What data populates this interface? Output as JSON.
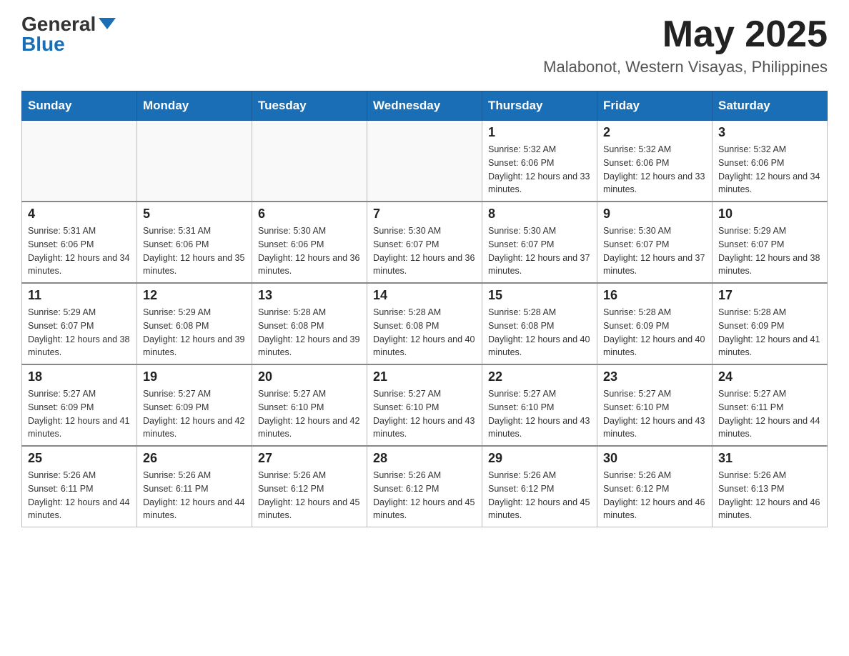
{
  "header": {
    "logo_general": "General",
    "logo_blue": "Blue",
    "month_title": "May 2025",
    "location": "Malabonot, Western Visayas, Philippines"
  },
  "days_of_week": [
    "Sunday",
    "Monday",
    "Tuesday",
    "Wednesday",
    "Thursday",
    "Friday",
    "Saturday"
  ],
  "weeks": [
    [
      {
        "day": "",
        "info": ""
      },
      {
        "day": "",
        "info": ""
      },
      {
        "day": "",
        "info": ""
      },
      {
        "day": "",
        "info": ""
      },
      {
        "day": "1",
        "info": "Sunrise: 5:32 AM\nSunset: 6:06 PM\nDaylight: 12 hours and 33 minutes."
      },
      {
        "day": "2",
        "info": "Sunrise: 5:32 AM\nSunset: 6:06 PM\nDaylight: 12 hours and 33 minutes."
      },
      {
        "day": "3",
        "info": "Sunrise: 5:32 AM\nSunset: 6:06 PM\nDaylight: 12 hours and 34 minutes."
      }
    ],
    [
      {
        "day": "4",
        "info": "Sunrise: 5:31 AM\nSunset: 6:06 PM\nDaylight: 12 hours and 34 minutes."
      },
      {
        "day": "5",
        "info": "Sunrise: 5:31 AM\nSunset: 6:06 PM\nDaylight: 12 hours and 35 minutes."
      },
      {
        "day": "6",
        "info": "Sunrise: 5:30 AM\nSunset: 6:06 PM\nDaylight: 12 hours and 36 minutes."
      },
      {
        "day": "7",
        "info": "Sunrise: 5:30 AM\nSunset: 6:07 PM\nDaylight: 12 hours and 36 minutes."
      },
      {
        "day": "8",
        "info": "Sunrise: 5:30 AM\nSunset: 6:07 PM\nDaylight: 12 hours and 37 minutes."
      },
      {
        "day": "9",
        "info": "Sunrise: 5:30 AM\nSunset: 6:07 PM\nDaylight: 12 hours and 37 minutes."
      },
      {
        "day": "10",
        "info": "Sunrise: 5:29 AM\nSunset: 6:07 PM\nDaylight: 12 hours and 38 minutes."
      }
    ],
    [
      {
        "day": "11",
        "info": "Sunrise: 5:29 AM\nSunset: 6:07 PM\nDaylight: 12 hours and 38 minutes."
      },
      {
        "day": "12",
        "info": "Sunrise: 5:29 AM\nSunset: 6:08 PM\nDaylight: 12 hours and 39 minutes."
      },
      {
        "day": "13",
        "info": "Sunrise: 5:28 AM\nSunset: 6:08 PM\nDaylight: 12 hours and 39 minutes."
      },
      {
        "day": "14",
        "info": "Sunrise: 5:28 AM\nSunset: 6:08 PM\nDaylight: 12 hours and 40 minutes."
      },
      {
        "day": "15",
        "info": "Sunrise: 5:28 AM\nSunset: 6:08 PM\nDaylight: 12 hours and 40 minutes."
      },
      {
        "day": "16",
        "info": "Sunrise: 5:28 AM\nSunset: 6:09 PM\nDaylight: 12 hours and 40 minutes."
      },
      {
        "day": "17",
        "info": "Sunrise: 5:28 AM\nSunset: 6:09 PM\nDaylight: 12 hours and 41 minutes."
      }
    ],
    [
      {
        "day": "18",
        "info": "Sunrise: 5:27 AM\nSunset: 6:09 PM\nDaylight: 12 hours and 41 minutes."
      },
      {
        "day": "19",
        "info": "Sunrise: 5:27 AM\nSunset: 6:09 PM\nDaylight: 12 hours and 42 minutes."
      },
      {
        "day": "20",
        "info": "Sunrise: 5:27 AM\nSunset: 6:10 PM\nDaylight: 12 hours and 42 minutes."
      },
      {
        "day": "21",
        "info": "Sunrise: 5:27 AM\nSunset: 6:10 PM\nDaylight: 12 hours and 43 minutes."
      },
      {
        "day": "22",
        "info": "Sunrise: 5:27 AM\nSunset: 6:10 PM\nDaylight: 12 hours and 43 minutes."
      },
      {
        "day": "23",
        "info": "Sunrise: 5:27 AM\nSunset: 6:10 PM\nDaylight: 12 hours and 43 minutes."
      },
      {
        "day": "24",
        "info": "Sunrise: 5:27 AM\nSunset: 6:11 PM\nDaylight: 12 hours and 44 minutes."
      }
    ],
    [
      {
        "day": "25",
        "info": "Sunrise: 5:26 AM\nSunset: 6:11 PM\nDaylight: 12 hours and 44 minutes."
      },
      {
        "day": "26",
        "info": "Sunrise: 5:26 AM\nSunset: 6:11 PM\nDaylight: 12 hours and 44 minutes."
      },
      {
        "day": "27",
        "info": "Sunrise: 5:26 AM\nSunset: 6:12 PM\nDaylight: 12 hours and 45 minutes."
      },
      {
        "day": "28",
        "info": "Sunrise: 5:26 AM\nSunset: 6:12 PM\nDaylight: 12 hours and 45 minutes."
      },
      {
        "day": "29",
        "info": "Sunrise: 5:26 AM\nSunset: 6:12 PM\nDaylight: 12 hours and 45 minutes."
      },
      {
        "day": "30",
        "info": "Sunrise: 5:26 AM\nSunset: 6:12 PM\nDaylight: 12 hours and 46 minutes."
      },
      {
        "day": "31",
        "info": "Sunrise: 5:26 AM\nSunset: 6:13 PM\nDaylight: 12 hours and 46 minutes."
      }
    ]
  ]
}
